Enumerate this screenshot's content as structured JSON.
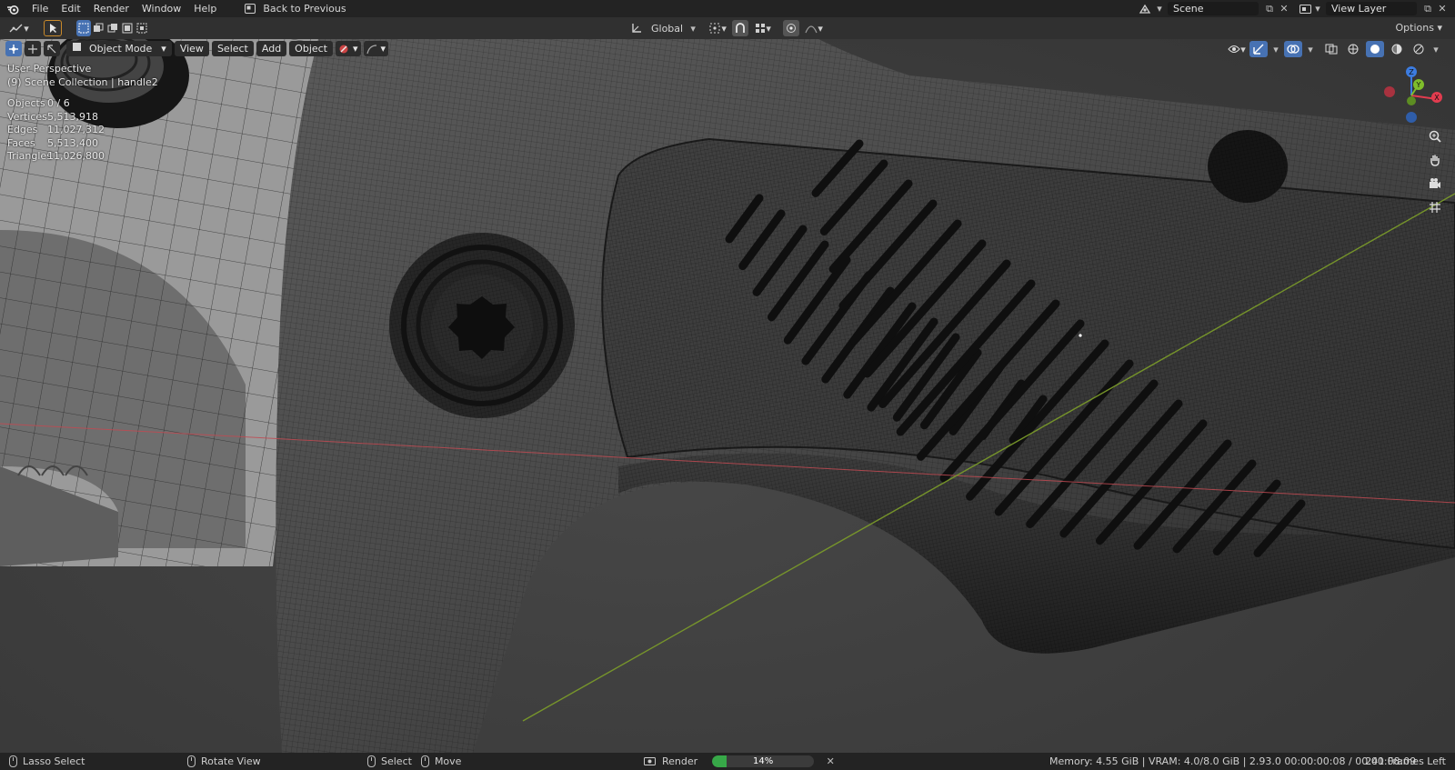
{
  "menu": {
    "items": [
      "File",
      "Edit",
      "Render",
      "Window",
      "Help"
    ],
    "back_label": "Back to Previous"
  },
  "top_right": {
    "scene_name": "Scene",
    "view_layer": "View Layer"
  },
  "header": {
    "orientation": "Global",
    "options_label": "Options"
  },
  "viewport_header": {
    "mode": "Object Mode",
    "menus": [
      "View",
      "Select",
      "Add",
      "Object"
    ]
  },
  "overlay": {
    "view_name": "User Perspective",
    "collection": "(9) Scene Collection | handle2"
  },
  "stats": [
    {
      "label": "Objects",
      "value": "0 / 6"
    },
    {
      "label": "Vertices",
      "value": "5,513,918"
    },
    {
      "label": "Edges",
      "value": "11,027,312"
    },
    {
      "label": "Faces",
      "value": "5,513,400"
    },
    {
      "label": "Triangles",
      "value": "11,026,800"
    }
  ],
  "gizmo": {
    "axes": [
      "Z",
      "Y",
      "X"
    ],
    "colors": {
      "x": "#e23c4f",
      "y": "#7fbd2b",
      "z": "#3c7ce0"
    }
  },
  "statusbar": {
    "lasso": "Lasso Select",
    "rotate": "Rotate View",
    "select": "Select",
    "move": "Move",
    "render_label": "Render",
    "render_progress": 0.14,
    "render_progress_text": "14%",
    "info": "Memory: 4.55 GiB | VRAM: 4.0/8.0 GiB | 2.93.0   00:00:00:08 / 00:00:08:09",
    "frames_left": "241 Frames Left"
  },
  "colors": {
    "accent": "#4772b3",
    "progress": "#37a848",
    "x_axis_line": "#c14a52",
    "y_axis_line": "#7a9a2a"
  }
}
